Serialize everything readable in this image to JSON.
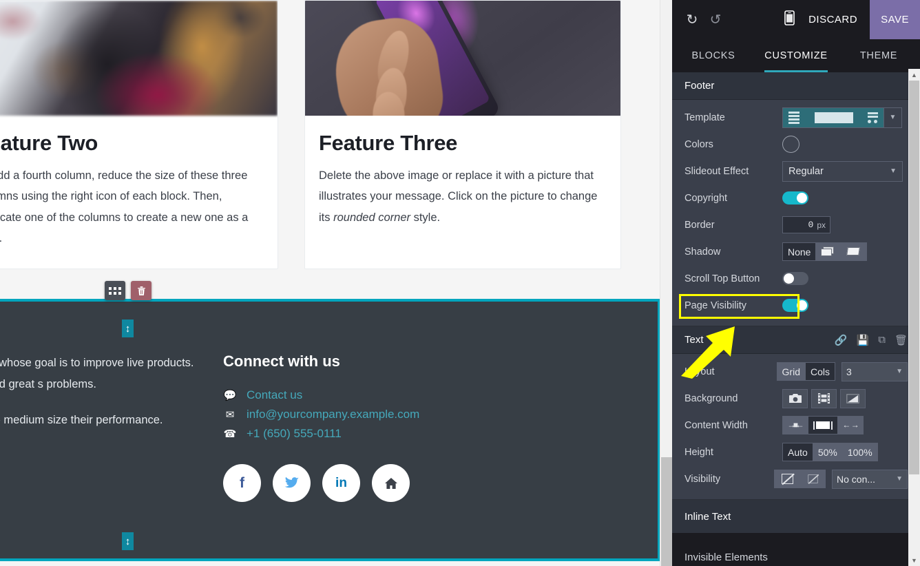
{
  "topbar": {
    "undo_icon": "undo-icon",
    "redo_icon": "redo-icon",
    "mobile_preview_icon": "mobile-phone-icon",
    "discard_label": "DISCARD",
    "save_label": "SAVE",
    "save_bg": "#7b6ea8"
  },
  "tabs": [
    {
      "label": "BLOCKS",
      "active": false
    },
    {
      "label": "CUSTOMIZE",
      "active": true
    },
    {
      "label": "THEME",
      "active": false
    }
  ],
  "accent_color": "#2fa8bb",
  "footer_section": {
    "title": "Footer",
    "rows": {
      "template": {
        "label": "Template",
        "value_icon": "layout-template-preview",
        "caret": "▼"
      },
      "colors": {
        "label": "Colors",
        "swatch": "#3d424e"
      },
      "slideout_effect": {
        "label": "Slideout Effect",
        "value": "Regular",
        "caret": "▼"
      },
      "copyright": {
        "label": "Copyright",
        "state": "on"
      },
      "border": {
        "label": "Border",
        "value": "0",
        "unit": "px"
      },
      "shadow": {
        "label": "Shadow",
        "options": [
          "None",
          "shadow-offset-icon",
          "shadow-lifted-icon"
        ],
        "selected": "None"
      },
      "scroll_top_button": {
        "label": "Scroll Top Button",
        "state": "off"
      },
      "page_visibility": {
        "label": "Page Visibility",
        "state": "on",
        "highlighted": true,
        "highlight_color": "#ffff00"
      }
    }
  },
  "text_section": {
    "title": "Text",
    "header_icons": [
      "link-icon",
      "save-icon",
      "duplicate-icon",
      "trash-icon"
    ],
    "rows": {
      "layout": {
        "label": "Layout",
        "options": [
          "Grid",
          "Cols"
        ],
        "selected": "Cols",
        "count": "3",
        "caret": "▼"
      },
      "background": {
        "label": "Background",
        "options": [
          "camera-icon",
          "video-icon",
          "gradient-icon"
        ]
      },
      "content_width": {
        "label": "Content Width",
        "options": [
          "width-narrow-icon",
          "width-boxed-icon",
          "width-full-icon"
        ],
        "selected": "width-boxed-icon"
      },
      "height": {
        "label": "Height",
        "options": [
          "Auto",
          "50%",
          "100%"
        ],
        "selected": "Auto"
      },
      "visibility": {
        "label": "Visibility",
        "options": [
          "hide-desktop-icon",
          "hide-mobile-icon"
        ],
        "condition": "No con...",
        "caret": "▼"
      }
    }
  },
  "inline_text_section": {
    "title": "Inline Text"
  },
  "invisible_elements_section": {
    "title": "Invisible Elements"
  },
  "canvas": {
    "feature_two": {
      "heading": "Feature Two",
      "body": "To add a fourth column, reduce the size of these three columns using the right icon of each block. Then, duplicate one of the columns to create a new one as a copy.",
      "image": "clothing-rack-photo"
    },
    "feature_three": {
      "heading": "Feature Three",
      "body_part1": "Delete the above image or replace it with a picture that illustrates your message. Click on the picture to change its ",
      "body_italic": "rounded corner",
      "body_part2": " style.",
      "image": "hand-holding-phone-photo"
    },
    "block_toolbar": {
      "grid_icon": "grid-options-icon",
      "trash_icon": "delete-block-icon"
    },
    "footer_preview": {
      "selected": true,
      "selection_color": "#00a5bd",
      "resize_handle_icon": "vertical-resize-handle",
      "left_text_1": "people whose goal is to improve live products. We build great s problems.",
      "left_text_2": "small to medium size their performance.",
      "connect_heading": "Connect with us",
      "links": [
        {
          "icon": "speech-bubble-icon",
          "label": "Contact us"
        },
        {
          "icon": "envelope-icon",
          "label": "info@yourcompany.example.com"
        },
        {
          "icon": "phone-icon",
          "label": "+1 (650) 555-0111"
        }
      ],
      "link_color": "#45a9bb",
      "socials": [
        {
          "name": "facebook-icon",
          "glyph": "f",
          "color": "#3b5998"
        },
        {
          "name": "twitter-icon",
          "glyph": "ᵗ",
          "color": "#55acee"
        },
        {
          "name": "linkedin-icon",
          "glyph": "in",
          "color": "#0077b5"
        },
        {
          "name": "home-icon",
          "glyph": "⌂",
          "color": "#3c4149"
        }
      ]
    }
  }
}
